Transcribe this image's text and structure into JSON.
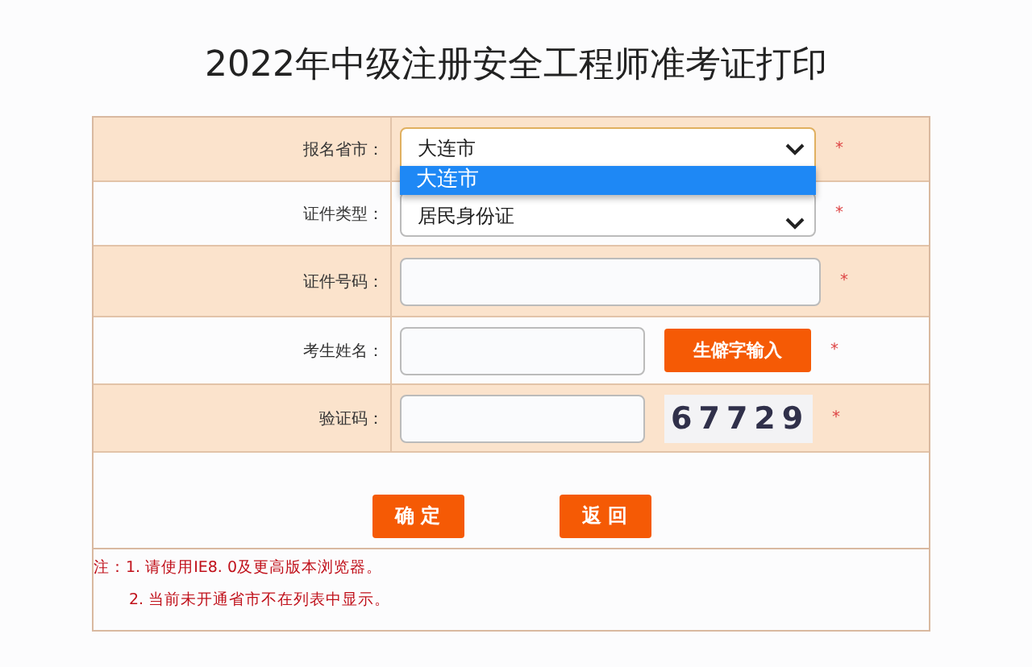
{
  "title": "2022年中级注册安全工程师准考证打印",
  "rows": [
    {
      "kind": "select",
      "label": "报名省市：",
      "value": "大连市",
      "required": "*",
      "open": true,
      "options": [
        {
          "label": "大连市",
          "selected": true
        }
      ]
    },
    {
      "kind": "select",
      "label": "证件类型：",
      "value": "居民身份证",
      "required": "*",
      "open": false
    },
    {
      "kind": "input",
      "label": "证件号码：",
      "required": "*"
    },
    {
      "kind": "input_button",
      "label": "考生姓名：",
      "button": "生僻字输入",
      "required": "*"
    },
    {
      "kind": "captcha",
      "label": "验证码：",
      "captcha": "67729",
      "required": "*"
    }
  ],
  "buttons": [
    "确 定",
    "返 回"
  ],
  "notes": [
    "注：1. 请使用IE8. 0及更高版本浏览器。",
    "2. 当前未开通省市不在列表中显示。"
  ]
}
